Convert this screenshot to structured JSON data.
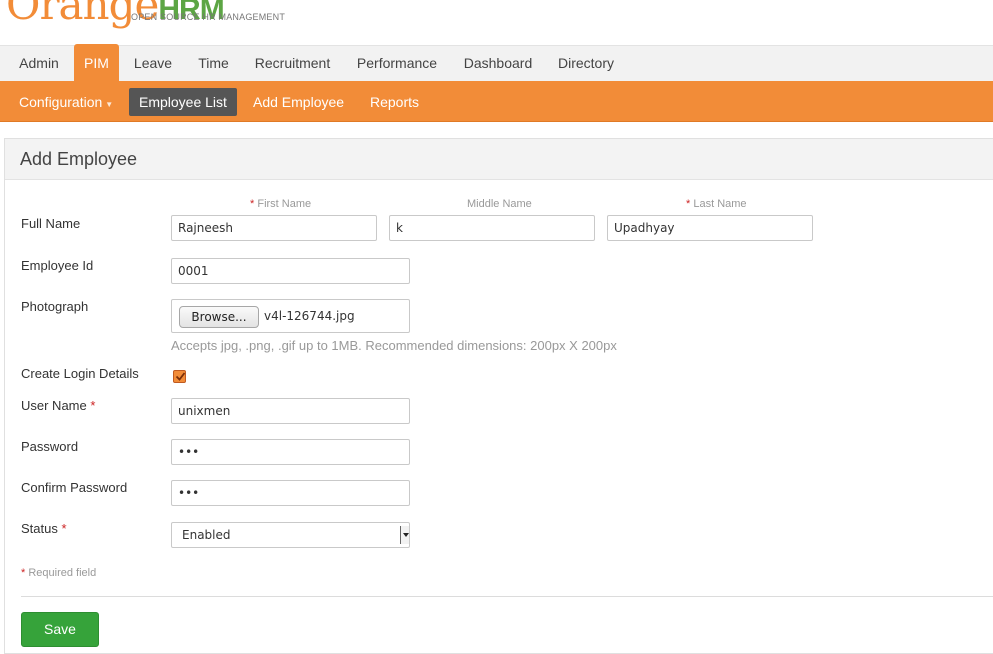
{
  "header": {
    "logo_o": "O",
    "logo_range": "range",
    "logo_hrm": "HRM",
    "tagline": "OPEN SOURCE HR MANAGEMENT"
  },
  "main_menu": {
    "items": [
      "Admin",
      "PIM",
      "Leave",
      "Time",
      "Recruitment",
      "Performance",
      "Dashboard",
      "Directory"
    ],
    "active": "PIM"
  },
  "sub_menu": {
    "configuration": "Configuration",
    "items": [
      "Employee List",
      "Add Employee",
      "Reports"
    ],
    "active": "Employee List"
  },
  "form": {
    "title": "Add Employee",
    "full_name_label": "Full Name",
    "first_name_caption": "First Name",
    "middle_name_caption": "Middle Name",
    "last_name_caption": "Last Name",
    "first_name": "Rajneesh",
    "middle_name": "k",
    "last_name": "Upadhyay",
    "employee_id_label": "Employee Id",
    "employee_id": "0001",
    "photograph_label": "Photograph",
    "browse_label": "Browse...",
    "file_name": "v4l-126744.jpg",
    "photo_hint": "Accepts jpg, .png, .gif up to 1MB. Recommended dimensions: 200px X 200px",
    "create_login_label": "Create Login Details",
    "create_login_checked": true,
    "user_name_label": "User Name",
    "user_name": "unixmen",
    "password_label": "Password",
    "password_mask": "•••",
    "confirm_password_label": "Confirm Password",
    "confirm_password_mask": "•••",
    "status_label": "Status",
    "status_value": "Enabled",
    "required_marker": "*",
    "required_note": "Required field",
    "save_label": "Save"
  },
  "colors": {
    "accent": "#f28c38",
    "logo_green": "#5ca544",
    "save_green": "#36a33a",
    "required_red": "#cc2222"
  }
}
